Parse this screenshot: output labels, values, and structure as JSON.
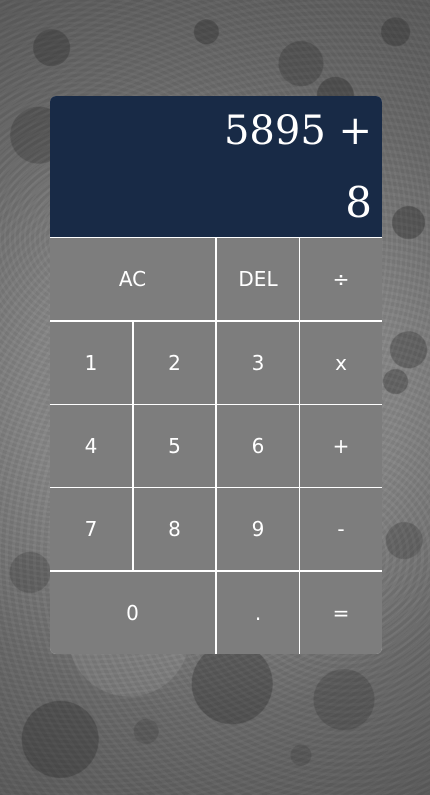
{
  "display": {
    "previous_operand": "5895 +",
    "current_operand": "8"
  },
  "buttons": {
    "ac": "AC",
    "del": "DEL",
    "divide": "÷",
    "multiply": "x",
    "add": "+",
    "subtract": "-",
    "equals": "=",
    "decimal": ".",
    "digit_0": "0",
    "digit_1": "1",
    "digit_2": "2",
    "digit_3": "3",
    "digit_4": "4",
    "digit_5": "5",
    "digit_6": "6",
    "digit_7": "7",
    "digit_8": "8",
    "digit_9": "9"
  },
  "colors": {
    "display_bg": "#182a46",
    "button_bg": "#7d7d7d",
    "text": "#ffffff",
    "grid_lines": "#ffffff"
  }
}
